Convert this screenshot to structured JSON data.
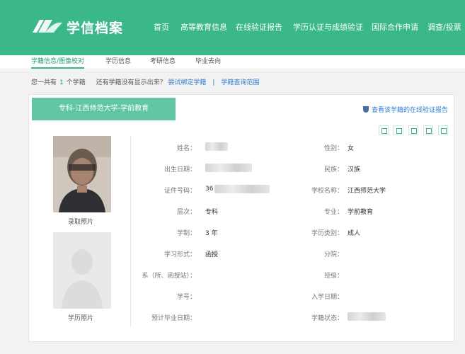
{
  "header": {
    "site_name": "学信档案",
    "nav": [
      "首页",
      "高等教育信息",
      "在线验证报告",
      "学历认证与成绩验证",
      "国际合作申请",
      "调查/投票"
    ]
  },
  "subnav": {
    "tabs": [
      "学籍信息/图像校对",
      "学历信息",
      "考研信息",
      "毕业去向"
    ]
  },
  "summary": {
    "prefix": "您一共有",
    "count": "1",
    "suffix": "个学籍",
    "question": "还有学籍没有显示出来？",
    "link_bind": "尝试绑定学籍",
    "separator": "|",
    "link_scope": "学籍查询范围"
  },
  "record": {
    "tab_title": "专科-江西师范大学-学前教育",
    "verify_link": "查看该学籍的在线验证报告",
    "tools": [
      "export-icon",
      "fullscreen-icon",
      "print-icon",
      "share-icon",
      "settings-icon"
    ],
    "photo_admission_label": "录取照片",
    "photo_education_label": "学历照片",
    "fields_left": [
      {
        "label": "姓名：",
        "value": ""
      },
      {
        "label": "出生日期：",
        "value": ""
      },
      {
        "label": "证件号码：",
        "value": "36"
      },
      {
        "label": "层次：",
        "value": "专科"
      },
      {
        "label": "学制：",
        "value": "3 年"
      },
      {
        "label": "学习形式：",
        "value": "函授"
      },
      {
        "label": "系（所、函授站）：",
        "value": ""
      },
      {
        "label": "学号：",
        "value": ""
      },
      {
        "label": "预计毕业日期：",
        "value": ""
      }
    ],
    "fields_right": [
      {
        "label": "性别：",
        "value": "女"
      },
      {
        "label": "民族：",
        "value": "汉族"
      },
      {
        "label": "学校名称：",
        "value": "江西师范大学"
      },
      {
        "label": "专业：",
        "value": "学前教育"
      },
      {
        "label": "学历类别：",
        "value": "成人"
      },
      {
        "label": "分院：",
        "value": ""
      },
      {
        "label": "班级：",
        "value": ""
      },
      {
        "label": "入学日期：",
        "value": ""
      },
      {
        "label": "学籍状态：",
        "value": ""
      }
    ]
  },
  "colors": {
    "brand_green": "#3bb88a",
    "tab_green": "#63c6a2",
    "link_blue": "#2e7fd0"
  }
}
